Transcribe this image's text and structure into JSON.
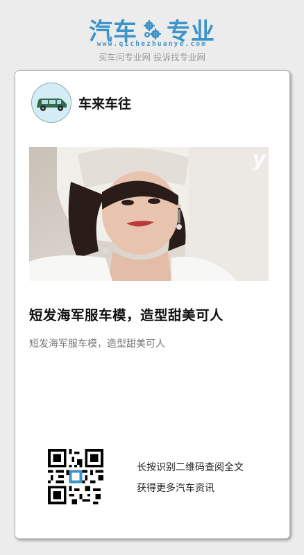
{
  "brand": {
    "name_left": "汽车",
    "name_right": "专业",
    "logo_icon": "gear-icon",
    "domain": "www.qichezhuanye.com",
    "slogan": "买车问专业网 投诉找专业网",
    "color": "#3d94c9"
  },
  "card": {
    "author_name": "车来车往",
    "avatar_icon": "car-avatar",
    "hero_image": "woman-in-white-sailor-hat-photo",
    "hero_caption": "y",
    "title": "短发海军服车模，造型甜美可人",
    "subtitle": "短发海军服车模，造型甜美可人",
    "qr_icon": "qr-code-icon",
    "prompt_line1": "长按识别二维码查阅全文",
    "prompt_line2": "获得更多汽车资讯"
  }
}
